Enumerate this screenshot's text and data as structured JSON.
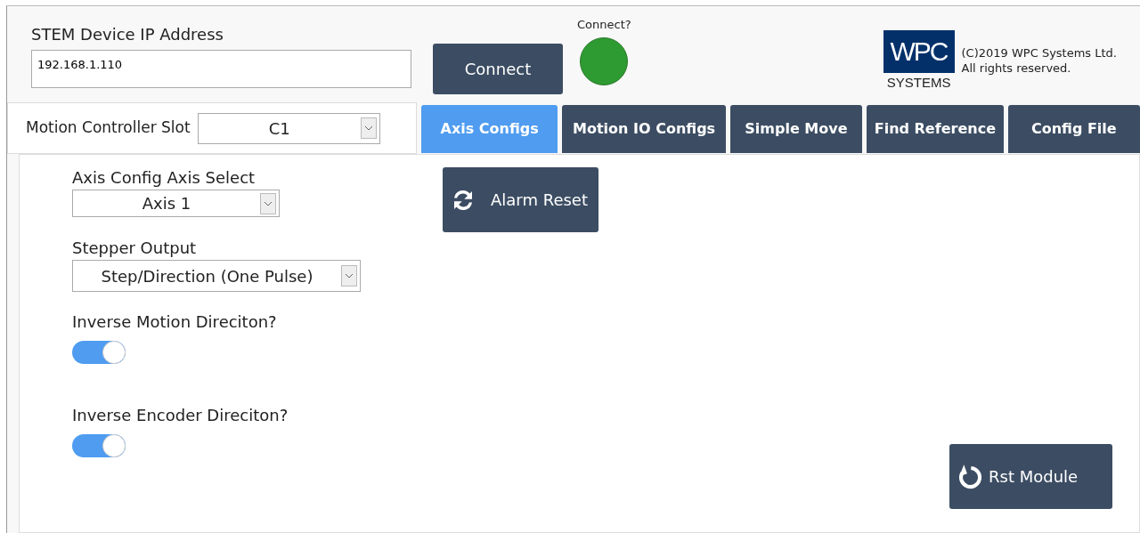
{
  "header": {
    "ip_label": "STEM Device IP Address",
    "ip_value": "192.168.1.110",
    "connect_button": "Connect",
    "status_label": "Connect?",
    "connected": true,
    "logo": {
      "mark": "WPC",
      "word": "SYSTEMS"
    },
    "copyright": [
      "(C)2019 WPC Systems Ltd.",
      "All rights reserved."
    ]
  },
  "slot": {
    "label": "Motion Controller Slot",
    "value": "C1"
  },
  "tabs": [
    {
      "label": "Axis Configs",
      "selected": true
    },
    {
      "label": "Motion IO Configs",
      "selected": false
    },
    {
      "label": "Simple Move",
      "selected": false
    },
    {
      "label": "Find Reference",
      "selected": false
    },
    {
      "label": "Config File",
      "selected": false
    }
  ],
  "form": {
    "axis_label": "Axis Config Axis Select",
    "axis_value": "Axis 1",
    "stepper_label": "Stepper Output",
    "stepper_value": "Step/Direction (One Pulse)",
    "toggles": [
      {
        "label": "Inverse Motion Direciton?",
        "on": true
      },
      {
        "label": "Inverse Encoder Direciton?",
        "on": true
      }
    ]
  },
  "alarm_button": "Alarm Reset",
  "reset_button": "Rst Module"
}
